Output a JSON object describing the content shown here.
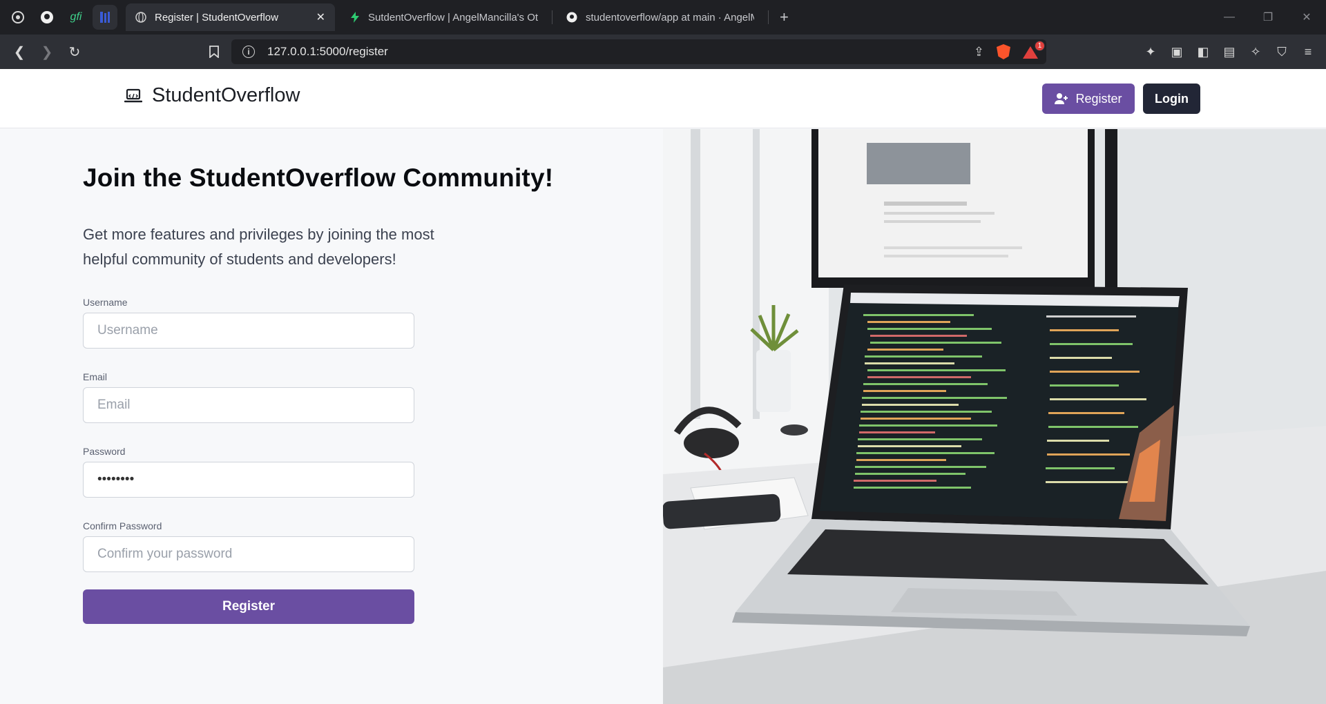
{
  "browser": {
    "tabs": [
      {
        "title": "Register | StudentOverflow",
        "active": true
      },
      {
        "title": "SutdentOverflow | AngelMancilla's Ot",
        "active": false
      },
      {
        "title": "studentoverflow/app at main · AngelM",
        "active": false
      }
    ],
    "pinned_icons": [
      "app-icon",
      "github-icon",
      "gfi-icon",
      "dashboard-icon"
    ],
    "pinned_gfi_text": "gfi",
    "url": "127.0.0.1:5000/register",
    "alert_badge": "1"
  },
  "navbar": {
    "brand": "StudentOverflow",
    "register_label": "Register",
    "login_label": "Login"
  },
  "main": {
    "heading": "Join the StudentOverflow Community!",
    "subtitle": "Get more features and privileges by joining the most helpful community of students and developers!",
    "form": {
      "username_label": "Username",
      "username_placeholder": "Username",
      "email_label": "Email",
      "email_placeholder": "Email",
      "password_label": "Password",
      "password_value": "••••••••",
      "confirm_label": "Confirm Password",
      "confirm_placeholder": "Confirm your password",
      "submit_label": "Register"
    }
  },
  "colors": {
    "accent": "#6a4ea2",
    "login_bg": "#222636",
    "tab_bar": "#1f2024"
  }
}
